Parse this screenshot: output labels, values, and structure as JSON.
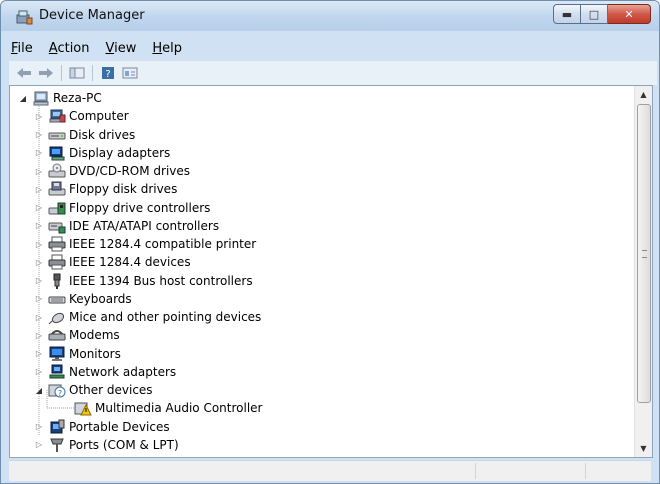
{
  "window": {
    "title": "Device Manager"
  },
  "menu": {
    "items": [
      {
        "label": "File",
        "accel": "F",
        "rest": "ile"
      },
      {
        "label": "Action",
        "accel": "A",
        "rest": "ction"
      },
      {
        "label": "View",
        "accel": "V",
        "rest": "iew"
      },
      {
        "label": "Help",
        "accel": "H",
        "rest": "elp"
      }
    ]
  },
  "toolbar": {
    "buttons": [
      "back-arrow-icon",
      "forward-arrow-icon",
      "console-icon",
      "help-icon",
      "properties-icon"
    ]
  },
  "tree": {
    "root": {
      "label": "Reza-PC",
      "icon": "computer-icon",
      "expanded": true
    },
    "items": [
      {
        "label": "Computer",
        "icon": "computer-icon",
        "expanded": false
      },
      {
        "label": "Disk drives",
        "icon": "disk-drive-icon",
        "expanded": false
      },
      {
        "label": "Display adapters",
        "icon": "display-adapter-icon",
        "expanded": false
      },
      {
        "label": "DVD/CD-ROM drives",
        "icon": "dvd-drive-icon",
        "expanded": false
      },
      {
        "label": "Floppy disk drives",
        "icon": "floppy-disk-icon",
        "expanded": false
      },
      {
        "label": "Floppy drive controllers",
        "icon": "floppy-controller-icon",
        "expanded": false
      },
      {
        "label": "IDE ATA/ATAPI controllers",
        "icon": "ide-controller-icon",
        "expanded": false
      },
      {
        "label": "IEEE 1284.4 compatible printer",
        "icon": "printer-icon",
        "expanded": false
      },
      {
        "label": "IEEE 1284.4 devices",
        "icon": "printer-icon",
        "expanded": false
      },
      {
        "label": "IEEE 1394 Bus host controllers",
        "icon": "firewire-icon",
        "expanded": false
      },
      {
        "label": "Keyboards",
        "icon": "keyboard-icon",
        "expanded": false
      },
      {
        "label": "Mice and other pointing devices",
        "icon": "mouse-icon",
        "expanded": false
      },
      {
        "label": "Modems",
        "icon": "modem-icon",
        "expanded": false
      },
      {
        "label": "Monitors",
        "icon": "monitor-icon",
        "expanded": false
      },
      {
        "label": "Network adapters",
        "icon": "network-adapter-icon",
        "expanded": false
      },
      {
        "label": "Other devices",
        "icon": "unknown-device-icon",
        "expanded": true
      },
      {
        "label": "Multimedia Audio Controller",
        "icon": "warning-device-icon",
        "child": true
      },
      {
        "label": "Portable Devices",
        "icon": "portable-device-icon",
        "expanded": false
      },
      {
        "label": "Ports (COM & LPT)",
        "icon": "port-icon",
        "expanded": false
      }
    ]
  },
  "colors": {
    "accent": "#3a6ea5",
    "titlebar": "#c0d6ee",
    "close": "#c03a2a",
    "warning": "#f3c300"
  }
}
